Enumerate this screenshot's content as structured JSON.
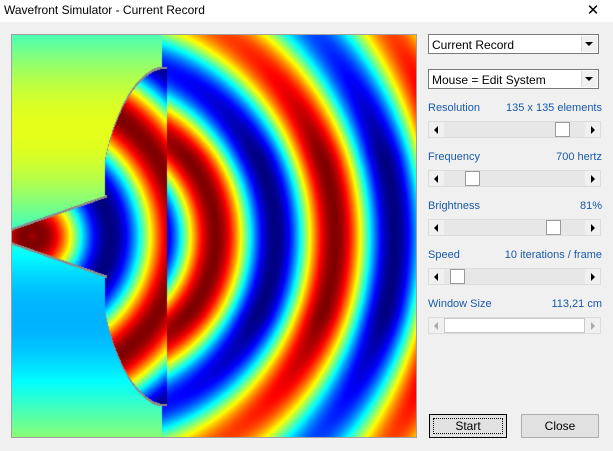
{
  "window": {
    "title": "Wavefront Simulator - Current Record",
    "close_glyph": "✕"
  },
  "controls": {
    "record_select": {
      "value": "Current Record"
    },
    "mouse_select": {
      "value": "Mouse = Edit System"
    },
    "resolution": {
      "label": "Resolution",
      "value": "135 x 135 elements",
      "position": 0.88
    },
    "frequency": {
      "label": "Frequency",
      "value": "700 hertz",
      "position": 0.17
    },
    "brightness": {
      "label": "Brightness",
      "value": "81%",
      "position": 0.81
    },
    "speed": {
      "label": "Speed",
      "value": "10 iterations / frame",
      "position": 0.05
    },
    "window_size": {
      "label": "Window Size",
      "value": "113,21 cm",
      "position": 1.0,
      "disabled": true
    }
  },
  "buttons": {
    "start_label": "Start",
    "close_label": "Close"
  },
  "colors": {
    "accent_label": "#1a5aaa",
    "wall": "#8c8c8c"
  },
  "icons": {
    "dropdown": "chevron-down-icon",
    "scroll_left": "arrow-left-icon",
    "scroll_right": "arrow-right-icon"
  }
}
